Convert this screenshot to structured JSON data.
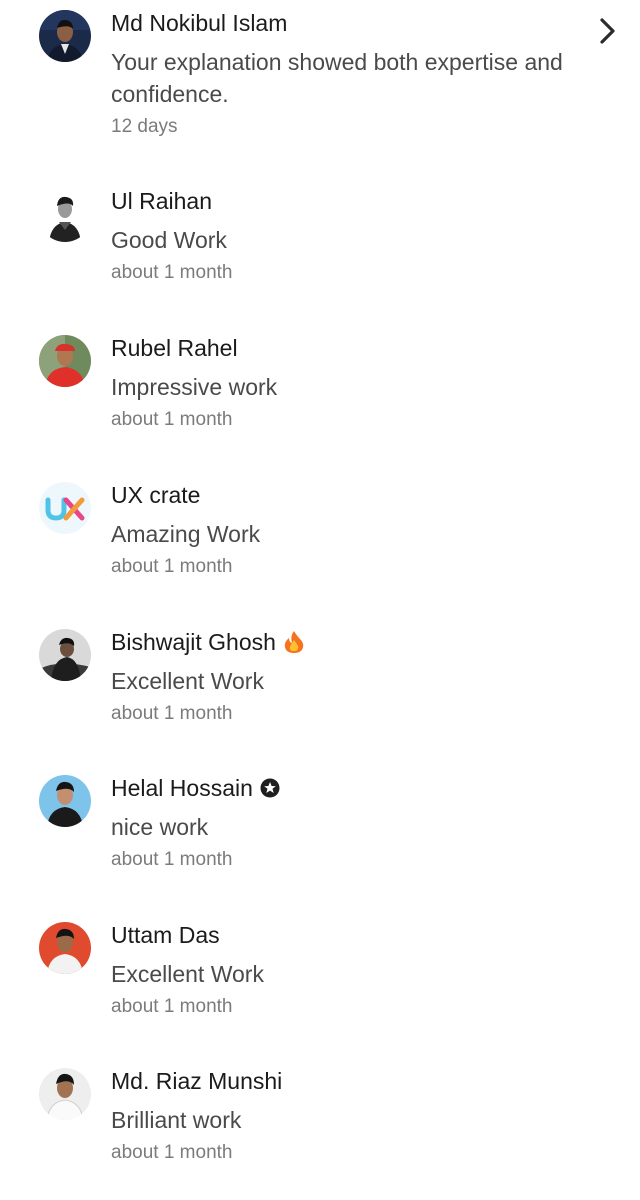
{
  "notifications": [
    {
      "name": "Md Nokibul Islam",
      "comment": "Your explanation showed both expertise and confidence.",
      "time": "12 days",
      "avatar_icon": "person-suit-avatar-icon"
    },
    {
      "name": "Ul Raihan",
      "comment": "Good Work",
      "time": "about 1 month",
      "avatar_icon": "person-bw-avatar-icon"
    },
    {
      "name": "Rubel Rahel",
      "comment": "Impressive work",
      "time": "about 1 month",
      "avatar_icon": "person-red-avatar-icon"
    },
    {
      "name": "UX crate",
      "comment": "Amazing Work",
      "time": "about 1 month",
      "avatar_icon": "ux-logo-avatar-icon",
      "logo_text": "UX"
    },
    {
      "name": "Bishwajit Ghosh",
      "comment": "Excellent Work",
      "time": "about 1 month",
      "avatar_icon": "person-dark-avatar-icon",
      "badge_icon": "fire-icon"
    },
    {
      "name": "Helal Hossain",
      "comment": "nice work",
      "time": "about 1 month",
      "avatar_icon": "person-blue-avatar-icon",
      "badge_icon": "star-badge-icon"
    },
    {
      "name": "Uttam Das",
      "comment": "Excellent Work",
      "time": "about 1 month",
      "avatar_icon": "person-orange-avatar-icon"
    },
    {
      "name": "Md. Riaz Munshi",
      "comment": "Brilliant work",
      "time": "about 1 month",
      "avatar_icon": "person-light-avatar-icon"
    }
  ],
  "chevron_icon": "chevron-right-icon",
  "colors": {
    "name_text": "#1b1b1b",
    "comment_text": "#4a4a4a",
    "time_text": "#7b7b7b",
    "fire": "#f5a623",
    "ux_cyan": "#4fc3e8",
    "ux_pink": "#e8458b"
  }
}
